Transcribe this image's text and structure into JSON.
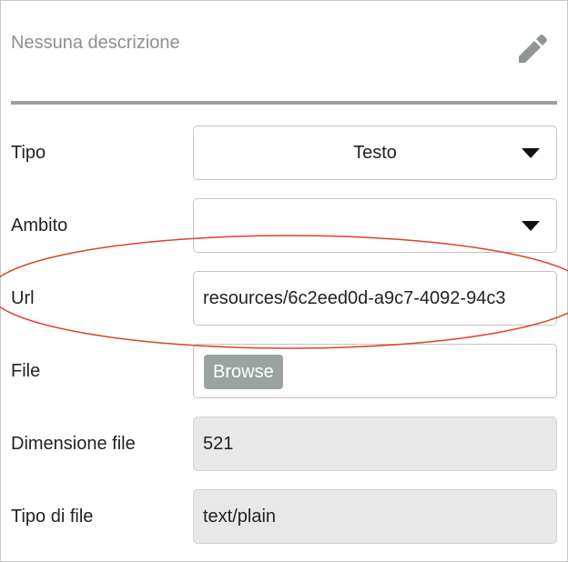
{
  "header": {
    "description": "Nessuna descrizione",
    "edit_icon": "pencil-icon"
  },
  "form": {
    "tipo": {
      "label": "Tipo",
      "value": "Testo",
      "icon": "caret-down-icon"
    },
    "ambito": {
      "label": "Ambito",
      "value": "",
      "icon": "caret-down-icon"
    },
    "url": {
      "label": "Url",
      "value": "resources/6c2eed0d-a9c7-4092-94c3"
    },
    "file": {
      "label": "File",
      "button_label": "Browse"
    },
    "dimensione_file": {
      "label": "Dimensione file",
      "value": "521"
    },
    "tipo_di_file": {
      "label": "Tipo di file",
      "value": "text/plain"
    }
  },
  "colors": {
    "divider": "#9aa09e",
    "browse_button": "#9aa39f",
    "readonly_field": "#e8e8e8",
    "annotation_ellipse": "#d9432c"
  }
}
